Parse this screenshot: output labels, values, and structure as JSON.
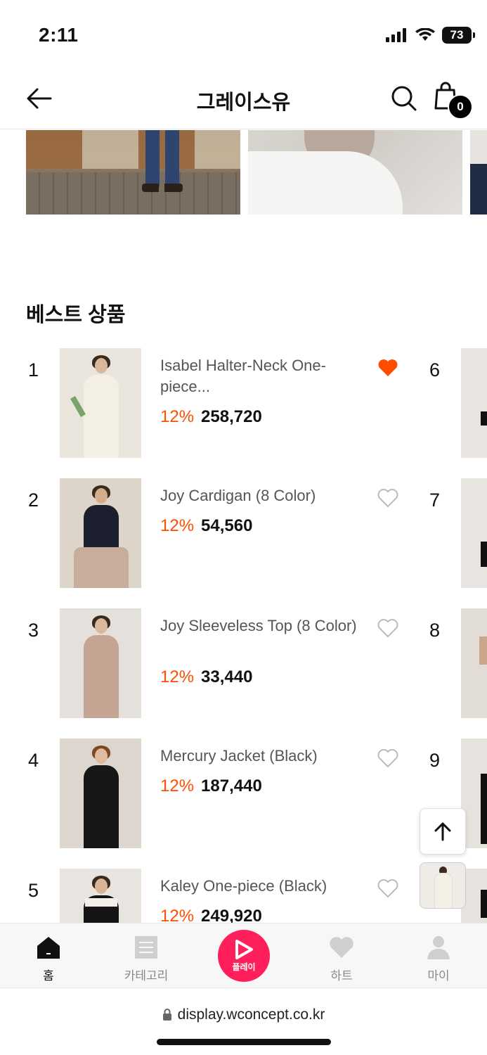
{
  "status_bar": {
    "time": "2:11",
    "battery": "73"
  },
  "header": {
    "title": "그레이스유",
    "cart_count": "0"
  },
  "section": {
    "title": "베스트 상품"
  },
  "products": [
    {
      "rank": "1",
      "name": "Isabel Halter-Neck One-piece...",
      "discount": "12%",
      "price": "258,720",
      "hearted": true
    },
    {
      "rank": "2",
      "name": "Joy Cardigan (8 Color)",
      "discount": "12%",
      "price": "54,560",
      "hearted": false
    },
    {
      "rank": "3",
      "name": "Joy Sleeveless Top (8 Color)",
      "discount": "12%",
      "price": "33,440",
      "hearted": false
    },
    {
      "rank": "4",
      "name": "Mercury Jacket (Black)",
      "discount": "12%",
      "price": "187,440",
      "hearted": false
    },
    {
      "rank": "5",
      "name": "Kaley One-piece (Black)",
      "discount": "12%",
      "price": "249,920",
      "hearted": false
    }
  ],
  "right_column_ranks": [
    "6",
    "7",
    "8",
    "9"
  ],
  "bottom_nav": {
    "home": "홈",
    "category": "카테고리",
    "play": "플레이",
    "heart": "하트",
    "my": "마이"
  },
  "browser": {
    "url": "display.wconcept.co.kr"
  },
  "colors": {
    "discount": "#ff4d00",
    "heart_active": "#ff4d00",
    "play": "#ff1f5a"
  }
}
